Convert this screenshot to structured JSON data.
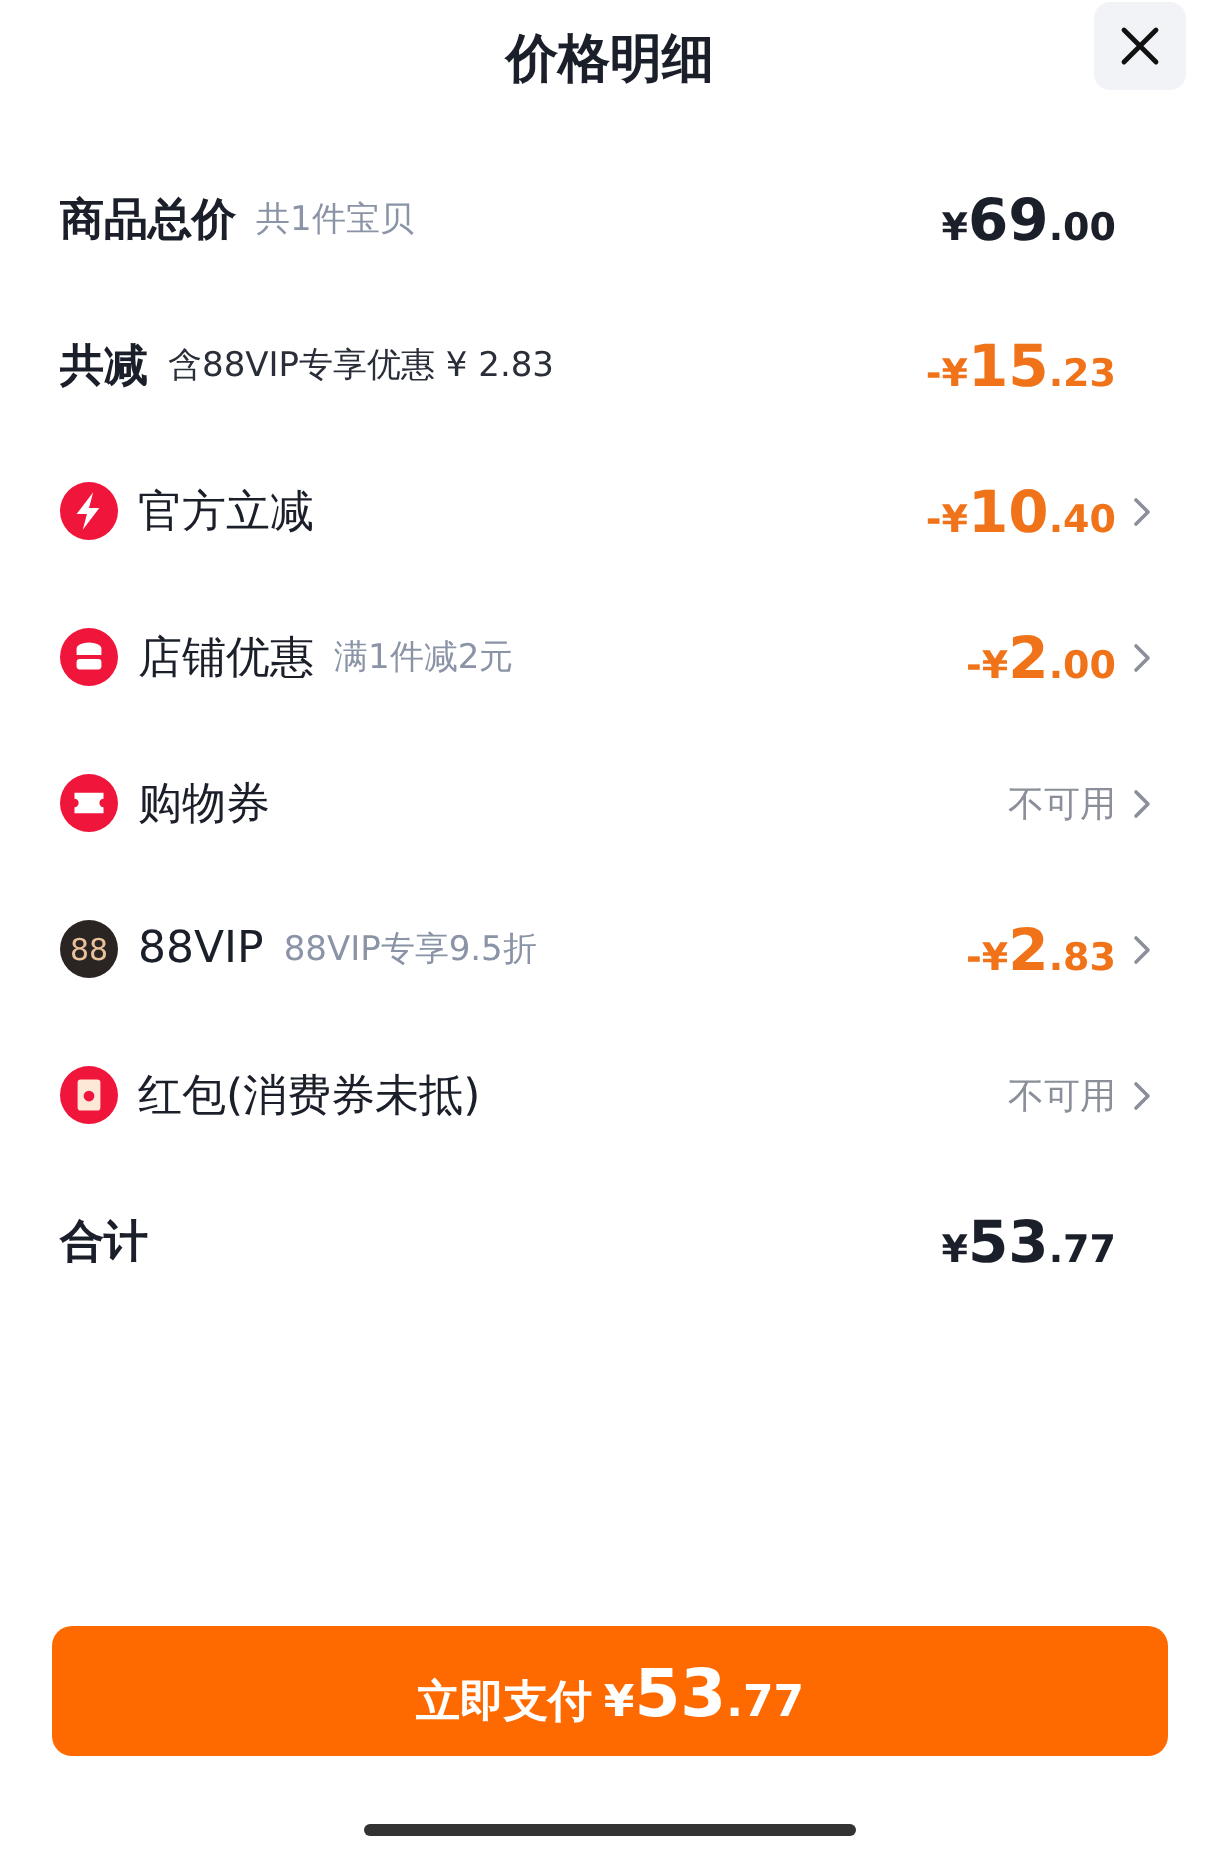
{
  "title": "价格明细",
  "rows": [
    {
      "kind": "total",
      "label": "商品总价",
      "note": "共1件宝贝",
      "price": {
        "currency": "¥",
        "whole": "69",
        "fraction": ".00"
      },
      "discount": false
    },
    {
      "kind": "reduction",
      "label": "共减",
      "note": "含88VIP专享优惠 ¥ 2.83",
      "price": {
        "currency": "-¥",
        "whole": "15",
        "fraction": ".23"
      },
      "discount": true
    },
    {
      "kind": "bolt",
      "label": "官方立减",
      "price": {
        "currency": "-¥",
        "whole": "10",
        "fraction": ".40"
      },
      "discount": true
    },
    {
      "kind": "shop",
      "label": "店铺优惠",
      "note": "满1件减2元",
      "price": {
        "currency": "-¥",
        "whole": "2",
        "fraction": ".00"
      },
      "discount": true
    },
    {
      "kind": "ticket",
      "label": "购物券",
      "status": "不可用"
    },
    {
      "kind": "vip",
      "icon_text": "88",
      "label": "88VIP",
      "note": "88VIP专享9.5折",
      "price": {
        "currency": "-¥",
        "whole": "2",
        "fraction": ".83"
      },
      "discount": true
    },
    {
      "kind": "envelope",
      "label": "红包(消费券未抵)",
      "status": "不可用"
    },
    {
      "kind": "total",
      "label": "合计",
      "price": {
        "currency": "¥",
        "whole": "53",
        "fraction": ".77"
      },
      "discount": false
    }
  ],
  "pay_button": {
    "label": "立即支付",
    "price": {
      "currency": "¥",
      "whole": "53",
      "fraction": ".77"
    }
  }
}
